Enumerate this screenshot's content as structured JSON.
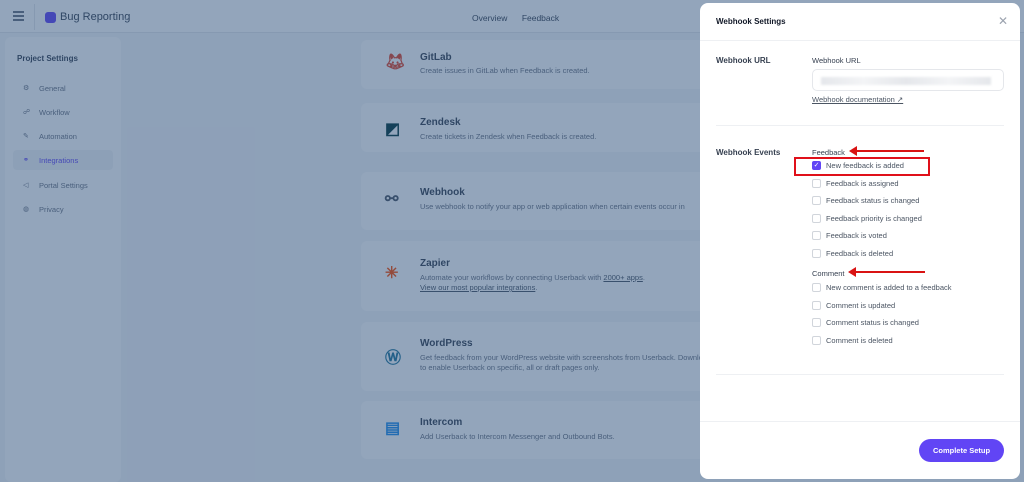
{
  "topbar": {
    "project": "Bug Reporting",
    "nav": [
      "Overview",
      "Feedback"
    ]
  },
  "sidebar": {
    "title": "Project Settings",
    "items": [
      {
        "label": "General",
        "icon": "⚙"
      },
      {
        "label": "Workflow",
        "icon": "☍"
      },
      {
        "label": "Automation",
        "icon": "✎"
      },
      {
        "label": "Integrations",
        "icon": "⚭"
      },
      {
        "label": "Portal Settings",
        "icon": "◁"
      },
      {
        "label": "Privacy",
        "icon": "◍"
      }
    ]
  },
  "integrations": [
    {
      "name": "GitLab",
      "desc": "Create issues in GitLab when Feedback is created.",
      "icon": "gitlab-icon"
    },
    {
      "name": "Zendesk",
      "desc": "Create tickets in Zendesk when Feedback is created.",
      "icon": "zendesk-icon"
    },
    {
      "name": "Webhook",
      "desc": "Use webhook to notify your app or web application when certain events occur in",
      "icon": "webhook-icon"
    },
    {
      "name": "Zapier",
      "desc": "Automate your workflows by connecting Userback with ",
      "link1": "2000+ apps",
      "link2": "View our most popular integrations",
      "icon": "zapier-icon"
    },
    {
      "name": "WordPress",
      "desc": "Get feedback from your WordPress website with screenshots from Userback. Download our plugin to enable Userback on specific, all or draft pages only.",
      "icon": "wordpress-icon"
    },
    {
      "name": "Intercom",
      "desc": "Add Userback to Intercom Messenger and Outbound Bots.",
      "icon": "intercom-icon"
    }
  ],
  "modal": {
    "title": "Webhook Settings",
    "url_section": "Webhook URL",
    "url_label": "Webhook URL",
    "doc_link": "Webhook documentation ↗",
    "events_section": "Webhook Events",
    "feedback_group": "Feedback",
    "feedback_events": [
      {
        "label": "New feedback is added",
        "checked": true
      },
      {
        "label": "Feedback is assigned",
        "checked": false
      },
      {
        "label": "Feedback status is changed",
        "checked": false
      },
      {
        "label": "Feedback priority is changed",
        "checked": false
      },
      {
        "label": "Feedback is voted",
        "checked": false
      },
      {
        "label": "Feedback is deleted",
        "checked": false
      }
    ],
    "comment_group": "Comment",
    "comment_events": [
      {
        "label": "New comment is added to a feedback",
        "checked": false
      },
      {
        "label": "Comment is updated",
        "checked": false
      },
      {
        "label": "Comment status is changed",
        "checked": false
      },
      {
        "label": "Comment is deleted",
        "checked": false
      }
    ],
    "submit": "Complete Setup"
  },
  "colors": {
    "accent": "#6145f5",
    "annotation": "#e0101a"
  }
}
